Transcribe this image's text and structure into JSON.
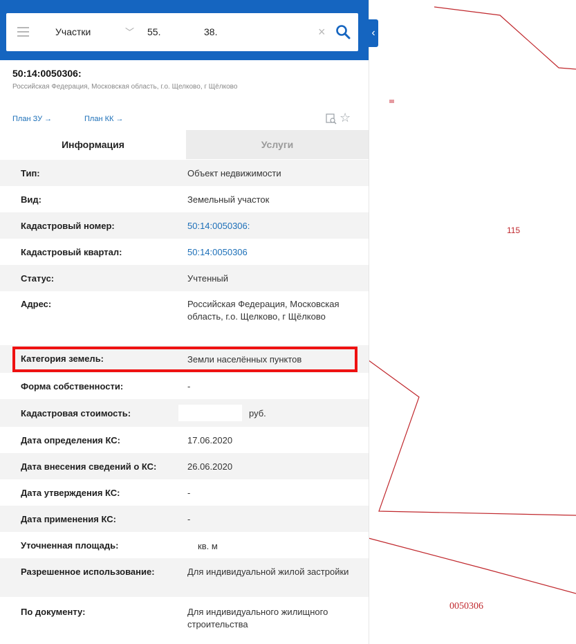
{
  "search": {
    "type_label": "Участки",
    "value_part1": "55.",
    "value_part2": "38.",
    "clear_glyph": "×",
    "collapse_glyph": "‹"
  },
  "object": {
    "cad_number": "50:14:0050306:",
    "address": "Российская Федерация, Московская область, г.о. Щелково, г Щёлково"
  },
  "links": {
    "plan_zu": "План ЗУ →",
    "plan_kk": "План КК →"
  },
  "tabs": {
    "info": "Информация",
    "services": "Услуги"
  },
  "rows": {
    "type": {
      "key": "Тип:",
      "value": "Объект недвижимости"
    },
    "kind": {
      "key": "Вид:",
      "value": "Земельный участок"
    },
    "cad_num": {
      "key": "Кадастровый номер:",
      "value": "50:14:0050306:"
    },
    "cad_quarter": {
      "key": "Кадастровый квартал:",
      "value": "50:14:0050306"
    },
    "status": {
      "key": "Статус:",
      "value": "Учтенный"
    },
    "address": {
      "key": "Адрес:",
      "value": "Российская Федерация, Московская область, г.о. Щелково, г Щёлково"
    },
    "land_category": {
      "key": "Категория земель:",
      "value": "Земли населённых пунктов"
    },
    "ownership": {
      "key": "Форма собственности:",
      "value": "-"
    },
    "cad_cost": {
      "key": "Кадастровая стоимость:",
      "value": "руб."
    },
    "cost_date_defined": {
      "key": "Дата определения КС:",
      "value": "17.06.2020"
    },
    "cost_date_entered": {
      "key": "Дата внесения сведений о КС:",
      "value": "26.06.2020"
    },
    "cost_date_approved": {
      "key": "Дата утверждения КС:",
      "value": "-"
    },
    "cost_date_applied": {
      "key": "Дата применения КС:",
      "value": "-"
    },
    "area": {
      "key": "Уточненная площадь:",
      "value": "кв. м"
    },
    "permitted_use": {
      "key": "Разрешенное использование:",
      "value": "Для индивидуальной жилой застройки"
    },
    "by_document": {
      "key": "По документу:",
      "value": "Для индивидуального жилищного строительства"
    }
  },
  "map": {
    "parcel_label": "115",
    "quarter_label": "0050306"
  },
  "colors": {
    "accent": "#1565c0",
    "link": "#1c6fb8",
    "highlight": "#ee1111",
    "boundary": "#c0282d"
  }
}
